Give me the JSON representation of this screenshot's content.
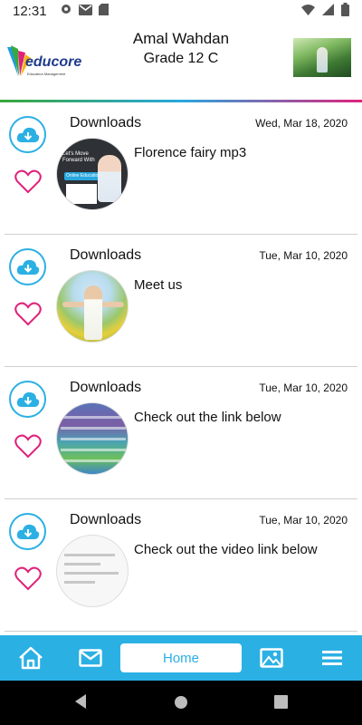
{
  "status_bar": {
    "time": "12:31",
    "left_icons": [
      "gear-icon",
      "gmail-icon",
      "sd-card-icon"
    ],
    "right_icons": [
      "wifi-icon",
      "signal-icon",
      "battery-icon"
    ]
  },
  "header": {
    "logo_text": "educore",
    "logo_tagline": "Education Management",
    "user_name": "Amal Wahdan",
    "user_grade": "Grade 12 C"
  },
  "posts": [
    {
      "category": "Downloads",
      "date": "Wed, Mar 18, 2020",
      "title": "Florence fairy mp3",
      "thumb_text": [
        "Let's Move",
        "Forward With",
        "Online Education"
      ]
    },
    {
      "category": "Downloads",
      "date": "Tue, Mar 10, 2020",
      "title": "Meet us"
    },
    {
      "category": "Downloads",
      "date": "Tue, Mar 10, 2020",
      "title": "Check out the link below"
    },
    {
      "category": "Downloads",
      "date": "Tue, Mar 10, 2020",
      "title": "Check out the video link below"
    }
  ],
  "bottom_nav": {
    "items": [
      "home-icon",
      "mail-icon",
      "Home",
      "gallery-icon",
      "menu-icon"
    ],
    "home_label": "Home",
    "active": "Home"
  },
  "colors": {
    "accent": "#2bb0e4",
    "like": "#e0217a",
    "header_line": [
      "#3aa83a",
      "#28a8e0",
      "#e0217a"
    ]
  }
}
